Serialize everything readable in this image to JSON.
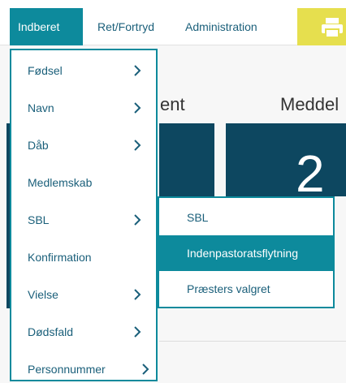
{
  "topnav": {
    "items": [
      "Indberet",
      "Ret/Fortryd",
      "Administration"
    ],
    "print_icon": "printer-icon"
  },
  "background": {
    "heading_partial": "ent",
    "heading_right_partial": "Meddel",
    "tile_number_partial": "2"
  },
  "menu": {
    "items": [
      {
        "label": "Fødsel",
        "has_submenu": true
      },
      {
        "label": "Navn",
        "has_submenu": true
      },
      {
        "label": "Dåb",
        "has_submenu": true
      },
      {
        "label": "Medlemskab",
        "has_submenu": false
      },
      {
        "label": "SBL",
        "has_submenu": true
      },
      {
        "label": "Konfirmation",
        "has_submenu": false
      },
      {
        "label": "Vielse",
        "has_submenu": true
      },
      {
        "label": "Dødsfald",
        "has_submenu": true
      },
      {
        "label": "Personnummer",
        "has_submenu": true
      }
    ]
  },
  "submenu": {
    "items": [
      {
        "label": "SBL",
        "selected": false
      },
      {
        "label": "Indenpastoratsflytning",
        "selected": true
      },
      {
        "label": "Præsters valgret",
        "selected": false
      }
    ]
  },
  "colors": {
    "accent": "#0d8a9c",
    "link": "#1a5f7a",
    "tile": "#0d4760",
    "print_button": "#e6df4e"
  }
}
